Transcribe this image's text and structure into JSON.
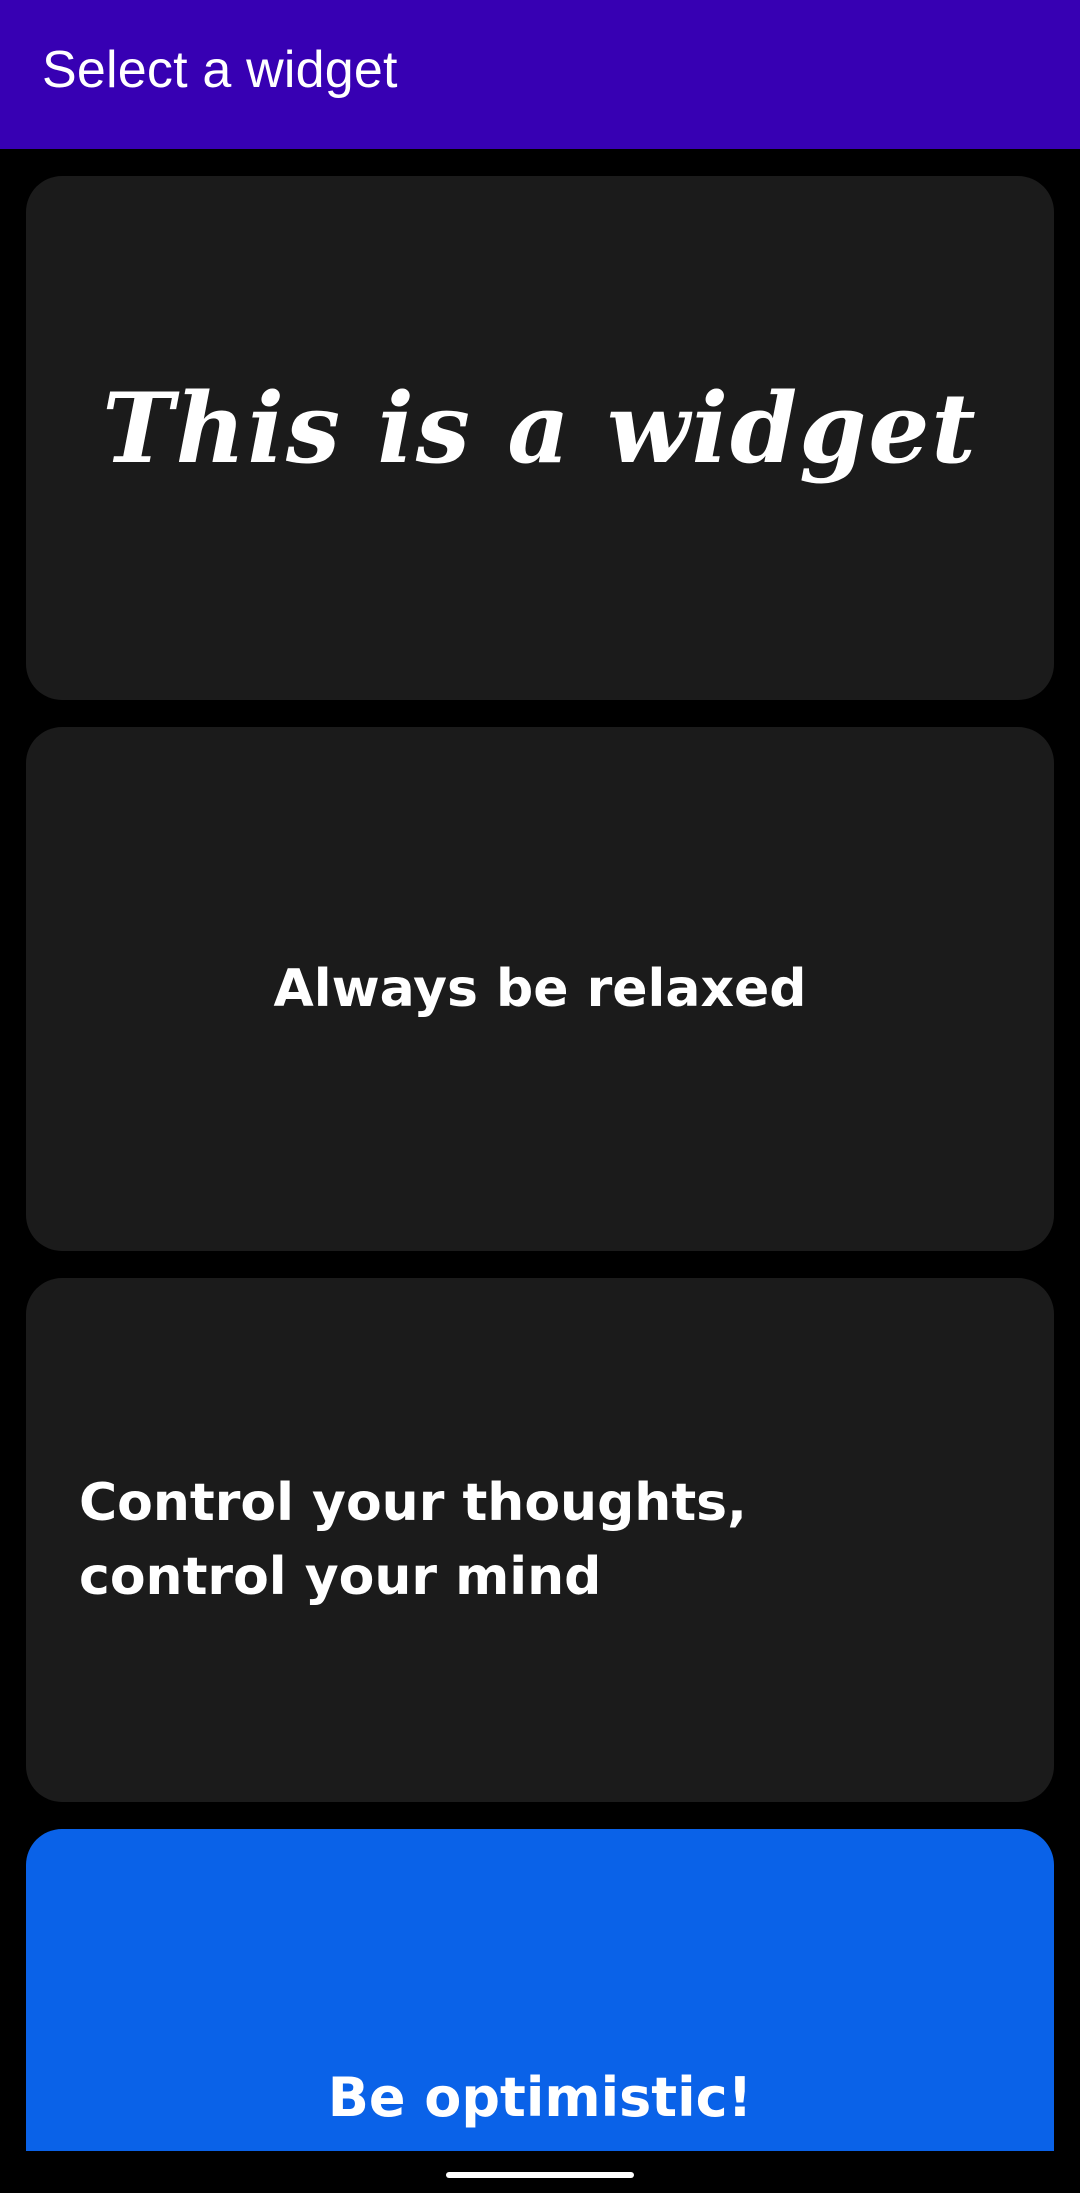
{
  "app_bar": {
    "title": "Select a widget",
    "background_color": "#3700B3"
  },
  "widgets": [
    {
      "text": "This is a widget",
      "background_color": "#1B1B1B",
      "style": "handwritten"
    },
    {
      "text": "Always be relaxed",
      "background_color": "#1B1B1B",
      "style": "bold"
    },
    {
      "text": "Control your thoughts, control your mind",
      "background_color": "#1B1B1B",
      "style": "bold"
    },
    {
      "text": "Be optimistic!",
      "background_color": "#0A62E8",
      "style": "bold"
    }
  ],
  "colors": {
    "screen_background": "#000000",
    "text": "#FFFFFF"
  }
}
